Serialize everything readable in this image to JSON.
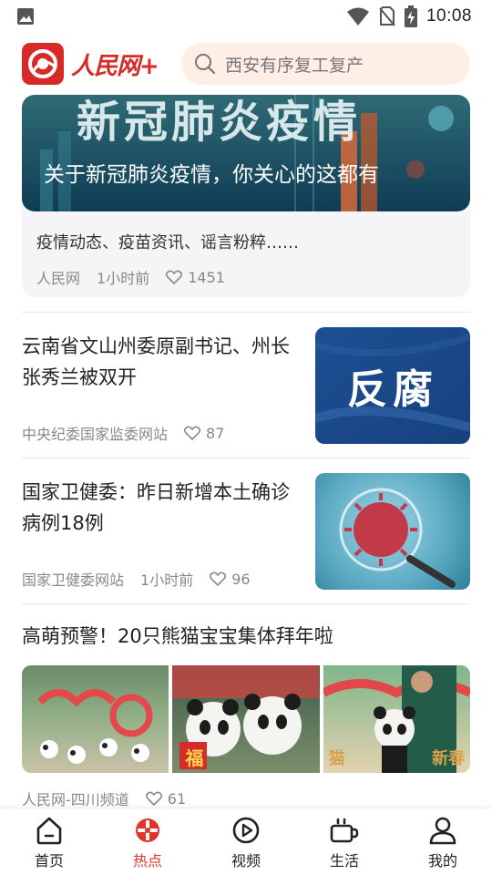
{
  "status_bar": {
    "time": "10:08"
  },
  "header": {
    "logo_text": "人民网+",
    "search_placeholder": "西安有序复工复产"
  },
  "banner": {
    "image_text": "新冠肺炎疫情",
    "caption": "关于新冠肺炎疫情，你关心的这都有",
    "description": "疫情动态、疫苗资讯、谣言粉粹……",
    "source": "人民网",
    "time": "1小时前",
    "likes": "1451"
  },
  "news": [
    {
      "title": "云南省文山州委原副书记、州长张秀兰被双开",
      "source": "中央纪委国家监委网站",
      "time": "",
      "likes": "87",
      "thumb_text": "反腐"
    },
    {
      "title": "国家卫健委：昨日新增本土确诊病例18例",
      "source": "国家卫健委网站",
      "time": "1小时前",
      "likes": "96",
      "thumb_text": ""
    }
  ],
  "gallery_item": {
    "title": "高萌预警！20只熊猫宝宝集体拜年啦",
    "source": "人民网-四川频道",
    "likes": "61",
    "image_texts": [
      "福",
      "猫",
      "新春"
    ]
  },
  "tabbar": {
    "items": [
      {
        "label": "首页",
        "icon": "home-icon",
        "active": false
      },
      {
        "label": "热点",
        "icon": "hot-icon",
        "active": true
      },
      {
        "label": "视频",
        "icon": "video-icon",
        "active": false
      },
      {
        "label": "生活",
        "icon": "life-icon",
        "active": false
      },
      {
        "label": "我的",
        "icon": "profile-icon",
        "active": false
      }
    ]
  },
  "colors": {
    "brand": "#d72a27",
    "accent": "#e0332a",
    "search_bg": "#fdeee6"
  }
}
